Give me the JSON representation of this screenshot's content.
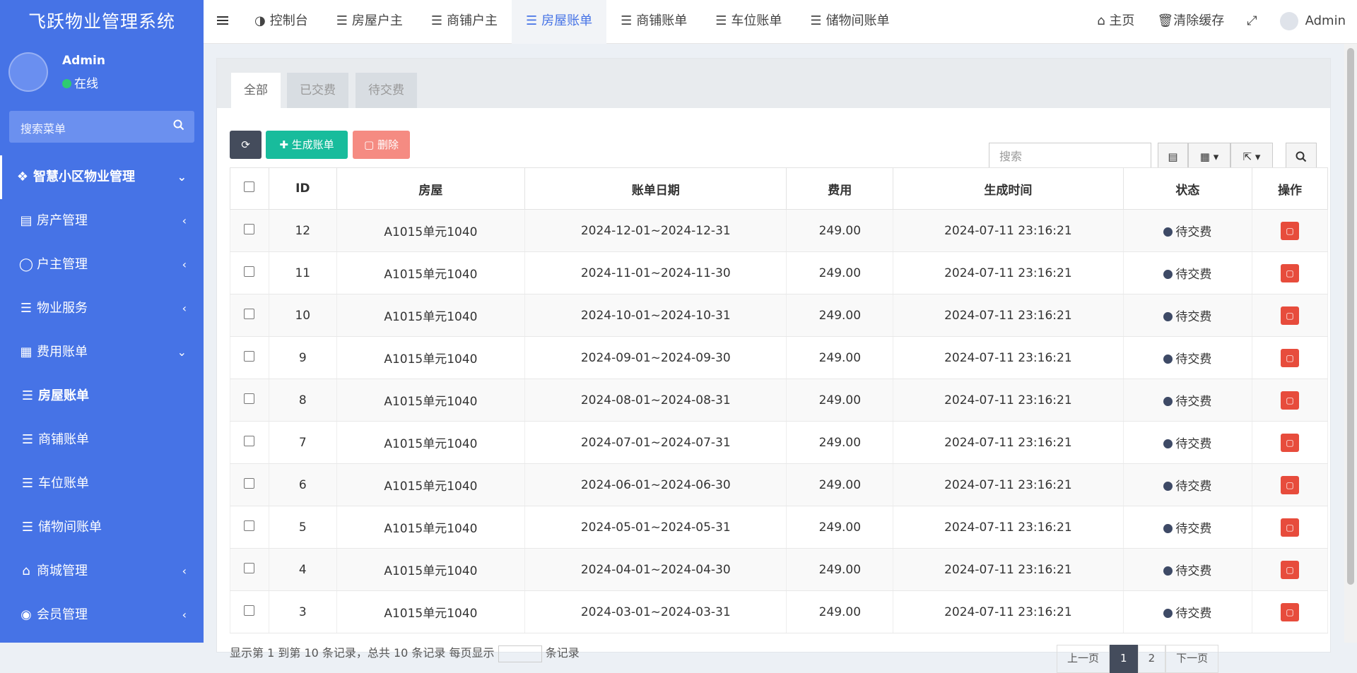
{
  "app": {
    "title": "飞跃物业管理系统"
  },
  "user": {
    "name": "Admin",
    "status": "在线"
  },
  "sidebar": {
    "search_placeholder": "搜索菜单",
    "items": [
      {
        "label": "智慧小区物业管理",
        "icon": "cubes-icon",
        "type": "header"
      },
      {
        "label": "房产管理",
        "icon": "building-icon"
      },
      {
        "label": "户主管理",
        "icon": "user-icon"
      },
      {
        "label": "物业服务",
        "icon": "server-icon"
      },
      {
        "label": "费用账单",
        "icon": "calendar-icon",
        "expanded": true
      },
      {
        "label": "房屋账单",
        "icon": "list-icon",
        "sub": true,
        "active": true
      },
      {
        "label": "商铺账单",
        "icon": "list-icon",
        "sub": true
      },
      {
        "label": "车位账单",
        "icon": "list-icon",
        "sub": true
      },
      {
        "label": "储物间账单",
        "icon": "list-icon",
        "sub": true
      },
      {
        "label": "商城管理",
        "icon": "bank-icon"
      },
      {
        "label": "会员管理",
        "icon": "user-circle-icon"
      }
    ]
  },
  "topnav": {
    "items": [
      {
        "label": "控制台",
        "icon": "dashboard-icon"
      },
      {
        "label": "房屋户主",
        "icon": "list-icon"
      },
      {
        "label": "商铺户主",
        "icon": "list-icon"
      },
      {
        "label": "房屋账单",
        "icon": "list-icon",
        "active": true
      },
      {
        "label": "商铺账单",
        "icon": "list-icon"
      },
      {
        "label": "车位账单",
        "icon": "list-icon"
      },
      {
        "label": "储物间账单",
        "icon": "list-icon"
      }
    ],
    "right": {
      "home": "主页",
      "clear_cache": "清除缓存",
      "user": "Admin"
    }
  },
  "tabs": [
    "全部",
    "已交费",
    "待交费"
  ],
  "toolbar": {
    "add": "生成账单",
    "delete": "删除",
    "search_placeholder": "搜索"
  },
  "table": {
    "headers": [
      "ID",
      "房屋",
      "账单日期",
      "费用",
      "生成时间",
      "状态",
      "操作"
    ],
    "rows": [
      {
        "id": "12",
        "house": "A1015单元1040",
        "period": "2024-12-01~2024-12-31",
        "fee": "249.00",
        "created": "2024-07-11 23:16:21",
        "status": "待交费"
      },
      {
        "id": "11",
        "house": "A1015单元1040",
        "period": "2024-11-01~2024-11-30",
        "fee": "249.00",
        "created": "2024-07-11 23:16:21",
        "status": "待交费"
      },
      {
        "id": "10",
        "house": "A1015单元1040",
        "period": "2024-10-01~2024-10-31",
        "fee": "249.00",
        "created": "2024-07-11 23:16:21",
        "status": "待交费"
      },
      {
        "id": "9",
        "house": "A1015单元1040",
        "period": "2024-09-01~2024-09-30",
        "fee": "249.00",
        "created": "2024-07-11 23:16:21",
        "status": "待交费"
      },
      {
        "id": "8",
        "house": "A1015单元1040",
        "period": "2024-08-01~2024-08-31",
        "fee": "249.00",
        "created": "2024-07-11 23:16:21",
        "status": "待交费"
      },
      {
        "id": "7",
        "house": "A1015单元1040",
        "period": "2024-07-01~2024-07-31",
        "fee": "249.00",
        "created": "2024-07-11 23:16:21",
        "status": "待交费"
      },
      {
        "id": "6",
        "house": "A1015单元1040",
        "period": "2024-06-01~2024-06-30",
        "fee": "249.00",
        "created": "2024-07-11 23:16:21",
        "status": "待交费"
      },
      {
        "id": "5",
        "house": "A1015单元1040",
        "period": "2024-05-01~2024-05-31",
        "fee": "249.00",
        "created": "2024-07-11 23:16:21",
        "status": "待交费"
      },
      {
        "id": "4",
        "house": "A1015单元1040",
        "period": "2024-04-01~2024-04-30",
        "fee": "249.00",
        "created": "2024-07-11 23:16:21",
        "status": "待交费"
      },
      {
        "id": "3",
        "house": "A1015单元1040",
        "period": "2024-03-01~2024-03-31",
        "fee": "249.00",
        "created": "2024-07-11 23:16:21",
        "status": "待交费"
      }
    ]
  },
  "footer": {
    "summary": "显示第 1 到第 10 条记录，总共 10 条记录 每页显示",
    "per_page_suffix": "条记录",
    "pages": [
      "上一页",
      "1",
      "2",
      "下一页"
    ]
  },
  "colors": {
    "sidebar": "#4673e6",
    "accent": "#4673e6",
    "success": "#18bc9c",
    "danger": "#e74c3c"
  }
}
